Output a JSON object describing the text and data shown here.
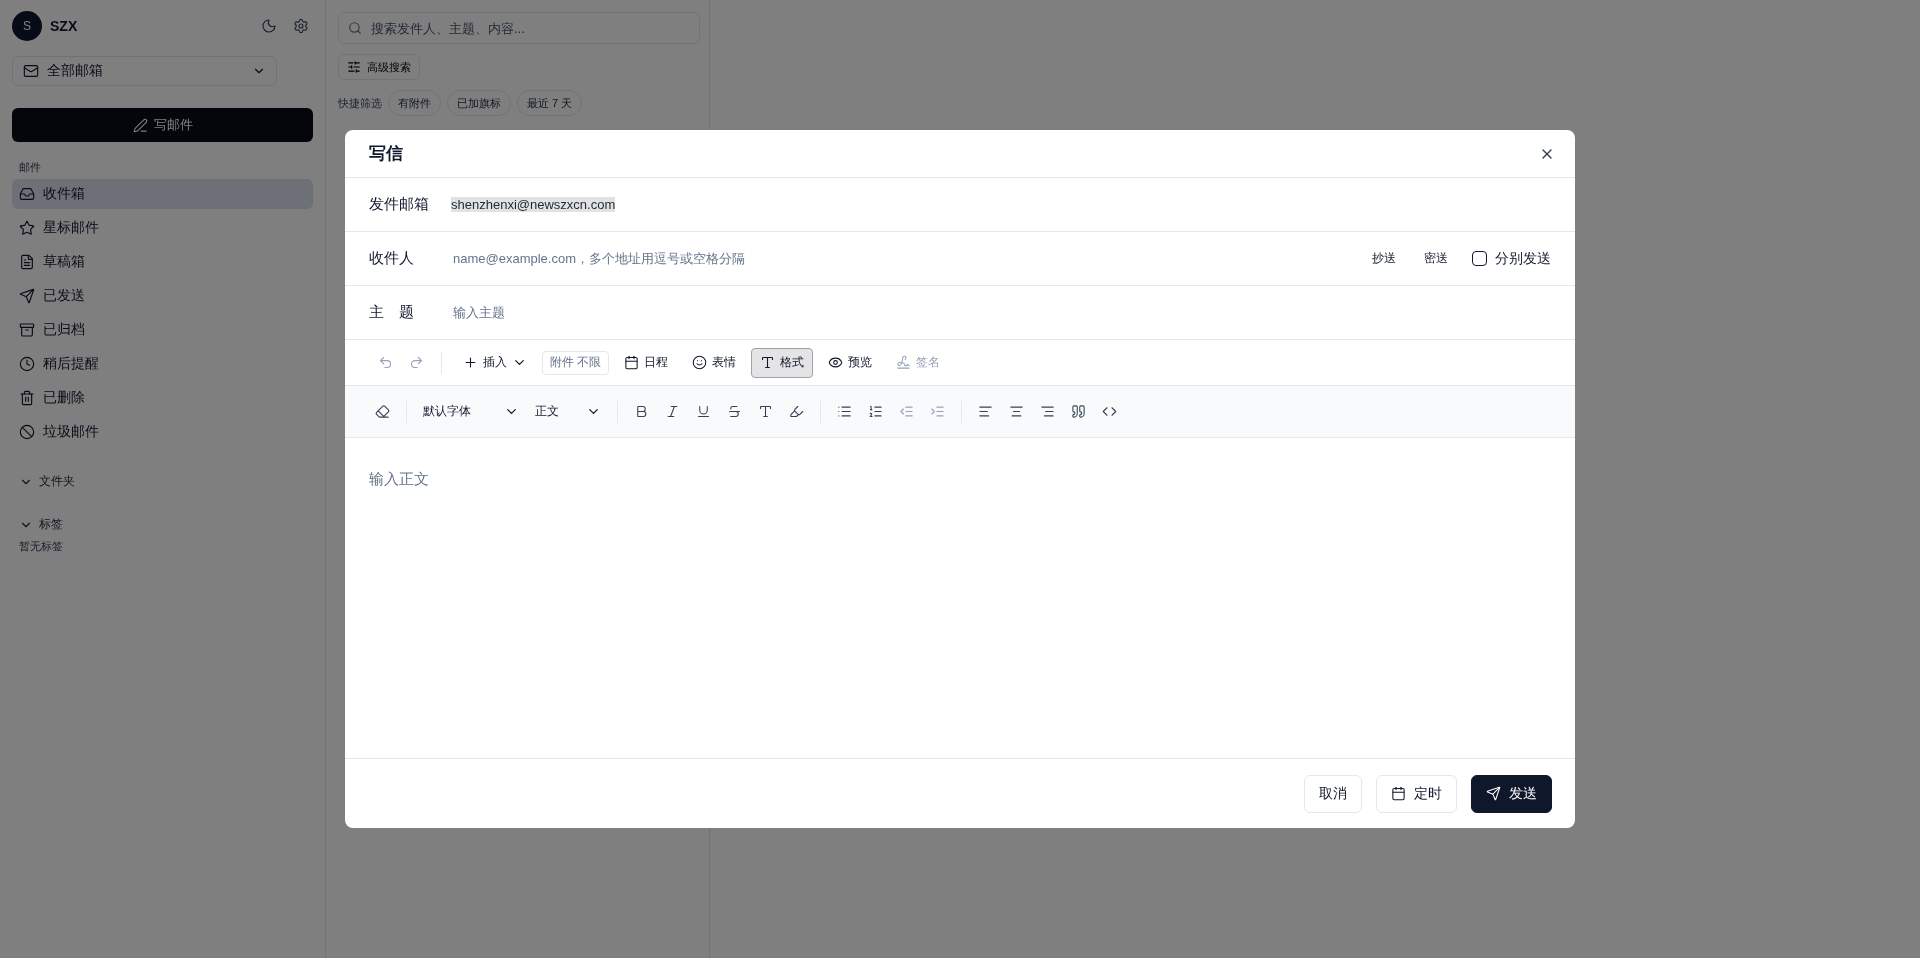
{
  "sidebar": {
    "avatar": "S",
    "user": "SZX",
    "mailbox_select": "全部邮箱",
    "compose_button": "写邮件",
    "section_label": "邮件",
    "items": [
      {
        "kind": "inbox",
        "label": "收件箱",
        "selected": true
      },
      {
        "kind": "star",
        "label": "星标邮件",
        "selected": false
      },
      {
        "kind": "draft",
        "label": "草稿箱",
        "selected": false
      },
      {
        "kind": "sent",
        "label": "已发送",
        "selected": false
      },
      {
        "kind": "archive",
        "label": "已归档",
        "selected": false
      },
      {
        "kind": "snooze",
        "label": "稍后提醒",
        "selected": false
      },
      {
        "kind": "trash",
        "label": "已删除",
        "selected": false
      },
      {
        "kind": "spam",
        "label": "垃圾邮件",
        "selected": false
      }
    ],
    "folders_label": "文件夹",
    "tags_label": "标签",
    "tags_empty": "暂无标签"
  },
  "search": {
    "placeholder": "搜索发件人、主题、内容..."
  },
  "advanced_search": "高级搜索",
  "quick_filters": {
    "label": "快捷筛选",
    "chips": [
      "有附件",
      "已加旗标",
      "最近 7 天"
    ]
  },
  "compose": {
    "title": "写信",
    "from": {
      "label": "发件邮箱",
      "value": "shenzhenxi@newszxcn.com"
    },
    "to": {
      "label": "收件人",
      "placeholder": "name@example.com，多个地址用逗号或空格分隔",
      "cc": "抄送",
      "bcc": "密送",
      "separate": {
        "label": "分别发送",
        "checked": false
      }
    },
    "subject": {
      "label": "主　题",
      "placeholder": "输入主题"
    },
    "history": [
      {
        "kind": "undo",
        "disabled": true
      },
      {
        "kind": "redo",
        "disabled": true
      }
    ],
    "actions": [
      {
        "kind": "insert",
        "label": "插入",
        "selected": false,
        "disabled": false
      },
      {
        "kind": "attachment",
        "label": "附件 不限",
        "selected": false,
        "disabled": false
      },
      {
        "kind": "schedule",
        "label": "日程",
        "selected": false,
        "disabled": false
      },
      {
        "kind": "emoji",
        "label": "表情",
        "selected": false,
        "disabled": false
      },
      {
        "kind": "format",
        "label": "格式",
        "selected": true,
        "disabled": false
      },
      {
        "kind": "preview",
        "label": "预览",
        "selected": false,
        "disabled": false
      },
      {
        "kind": "signature",
        "label": "签名",
        "selected": false,
        "disabled": true
      }
    ],
    "format_groups": [
      {
        "kind": "tools",
        "tools": [
          {
            "kind": "eraser",
            "disabled": false
          }
        ]
      },
      {
        "kind": "selects",
        "selects": [
          "默认字体",
          "正文"
        ]
      },
      {
        "kind": "tools",
        "tools": [
          {
            "kind": "bold",
            "disabled": false
          },
          {
            "kind": "italic",
            "disabled": false
          },
          {
            "kind": "underline",
            "disabled": false
          },
          {
            "kind": "strike",
            "disabled": false
          },
          {
            "kind": "text",
            "disabled": false
          },
          {
            "kind": "highlight",
            "disabled": false
          }
        ]
      },
      {
        "kind": "tools",
        "tools": [
          {
            "kind": "bullets",
            "disabled": false
          },
          {
            "kind": "numbers",
            "disabled": false
          },
          {
            "kind": "outdent",
            "disabled": true
          },
          {
            "kind": "indent",
            "disabled": true
          }
        ]
      },
      {
        "kind": "tools",
        "tools": [
          {
            "kind": "align-left",
            "disabled": false
          },
          {
            "kind": "align-center",
            "disabled": false
          },
          {
            "kind": "align-right",
            "disabled": false
          },
          {
            "kind": "quote",
            "disabled": false
          },
          {
            "kind": "code",
            "disabled": false
          }
        ]
      }
    ],
    "body": {
      "placeholder": "输入正文"
    },
    "footer": {
      "cancel": "取消",
      "schedule": "定时",
      "send": "发送"
    }
  }
}
